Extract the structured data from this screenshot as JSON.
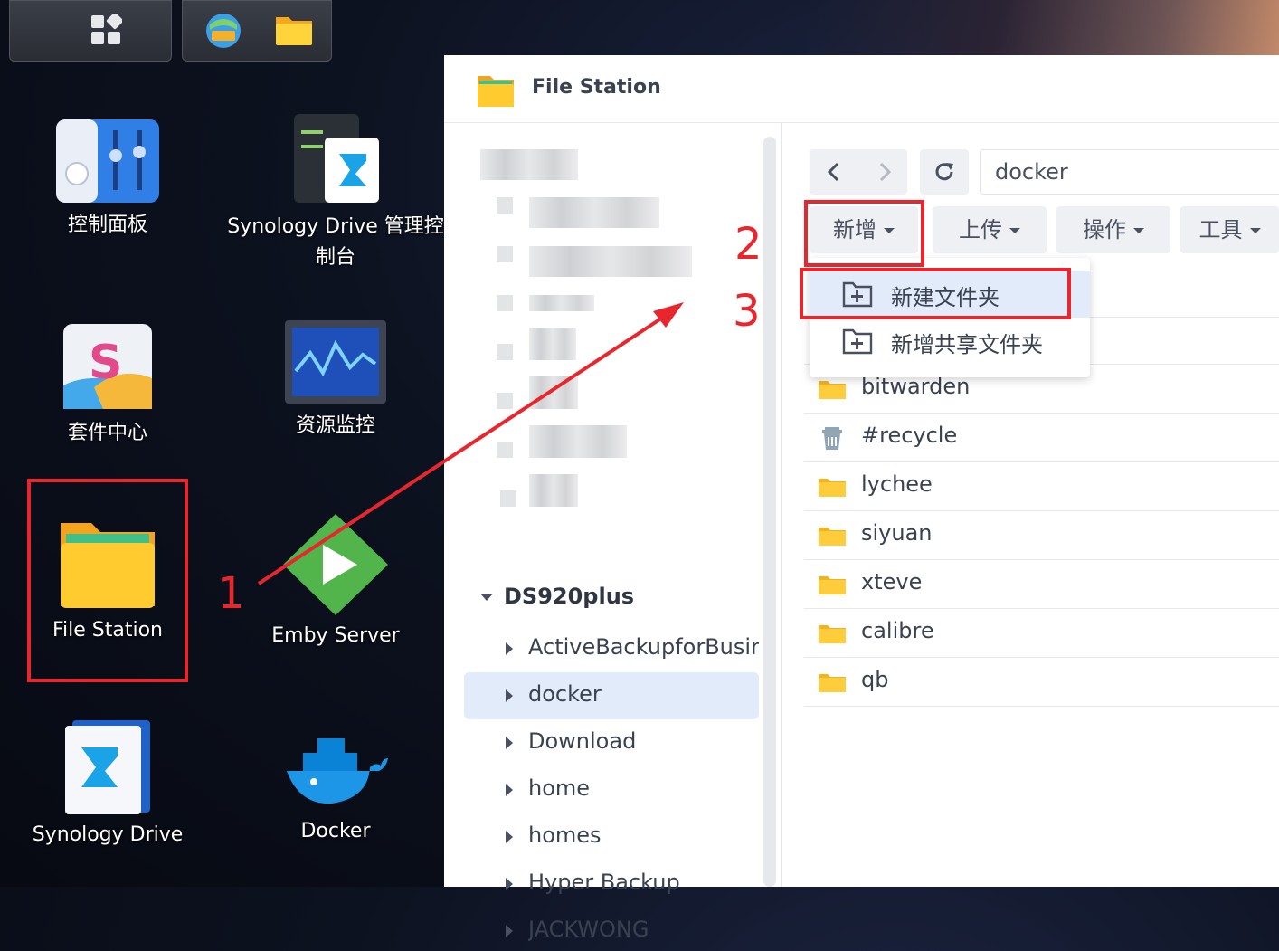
{
  "window": {
    "title": "File Station"
  },
  "desktop": {
    "icons": [
      {
        "label": "控制面板"
      },
      {
        "label": "Synology Drive 管理控制台"
      },
      {
        "label": "套件中心"
      },
      {
        "label": "资源监控"
      },
      {
        "label": "File Station"
      },
      {
        "label": "Emby Server"
      },
      {
        "label": "Synology Drive"
      },
      {
        "label": "Docker"
      }
    ]
  },
  "annotations": {
    "step1": "1",
    "step2": "2",
    "step3": "3",
    "accent": "#e8262d"
  },
  "sidebar": {
    "root": "DS920plus",
    "items": [
      {
        "label": "ActiveBackupforBusiness"
      },
      {
        "label": "docker"
      },
      {
        "label": "Download"
      },
      {
        "label": "home"
      },
      {
        "label": "homes"
      },
      {
        "label": "Hyper Backup"
      },
      {
        "label": "JACKWONG"
      }
    ]
  },
  "toolbar": {
    "path": "docker",
    "new_label": "新增",
    "upload_label": "上传",
    "action_label": "操作",
    "tools_label": "工具"
  },
  "menu": {
    "items": [
      {
        "label": "新建文件夹"
      },
      {
        "label": "新增共享文件夹"
      }
    ]
  },
  "files": [
    {
      "name": "bitwarden",
      "icon": "folder-icon"
    },
    {
      "name": "#recycle",
      "icon": "trash-icon"
    },
    {
      "name": "lychee",
      "icon": "folder-icon"
    },
    {
      "name": "siyuan",
      "icon": "folder-icon"
    },
    {
      "name": "xteve",
      "icon": "folder-icon"
    },
    {
      "name": "calibre",
      "icon": "folder-icon"
    },
    {
      "name": "qb",
      "icon": "folder-icon"
    }
  ]
}
